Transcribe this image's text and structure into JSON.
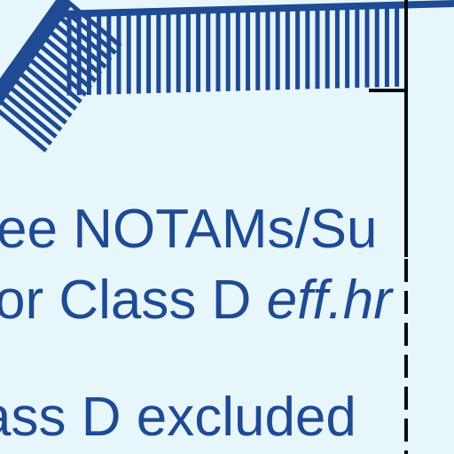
{
  "map": {
    "background_color": "#e6f6fb",
    "ink_color": "#1f4a94",
    "boundary_color": "#0a0a0a",
    "notes": {
      "line1": "ee NOTAMs/Su",
      "line2_normal": "or Class D ",
      "line2_italic": "eff.hr",
      "line3": "ass D excluded"
    },
    "symbols": [
      "airspace-boundary-hatched",
      "class-d-boundary-dashed"
    ]
  }
}
